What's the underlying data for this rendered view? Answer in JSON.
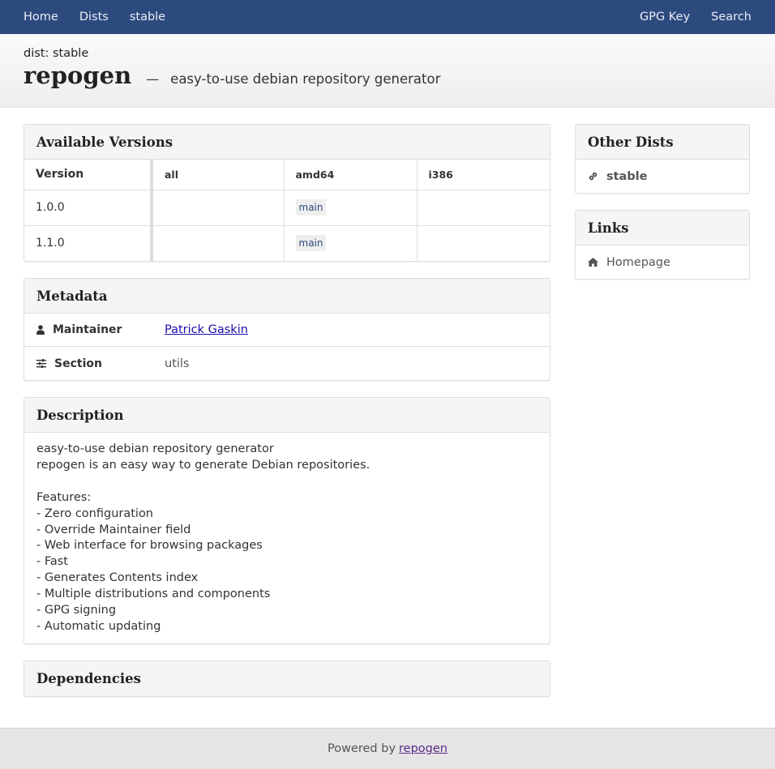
{
  "nav": {
    "left": [
      "Home",
      "Dists",
      "stable"
    ],
    "right": [
      "GPG Key",
      "Search"
    ]
  },
  "header": {
    "dist_label": "dist: stable",
    "package_name": "repogen",
    "dash": "—",
    "tagline": "easy-to-use debian repository generator"
  },
  "versions": {
    "title": "Available Versions",
    "columns": [
      "Version",
      "all",
      "amd64",
      "i386"
    ],
    "rows": [
      {
        "version": "1.0.0",
        "all": "",
        "amd64": "main",
        "i386": ""
      },
      {
        "version": "1.1.0",
        "all": "",
        "amd64": "main",
        "i386": ""
      }
    ]
  },
  "metadata": {
    "title": "Metadata",
    "maintainer_label": "Maintainer",
    "maintainer_value": "Patrick Gaskin",
    "section_label": "Section",
    "section_value": "utils"
  },
  "description": {
    "title": "Description",
    "text": "easy-to-use debian repository generator\nrepogen is an easy way to generate Debian repositories.\n\nFeatures:\n- Zero configuration\n- Override Maintainer field\n- Web interface for browsing packages\n- Fast\n- Generates Contents index\n- Multiple distributions and components\n- GPG signing\n- Automatic updating"
  },
  "dependencies": {
    "title": "Dependencies"
  },
  "other_dists": {
    "title": "Other Dists",
    "items": [
      "stable"
    ]
  },
  "links": {
    "title": "Links",
    "items": [
      "Homepage"
    ]
  },
  "footer": {
    "text": "Powered by",
    "link": "repogen"
  },
  "colors": {
    "navbar": "#2d4a7f",
    "link": "#1a0dab",
    "footer_link": "#5b2a86"
  }
}
